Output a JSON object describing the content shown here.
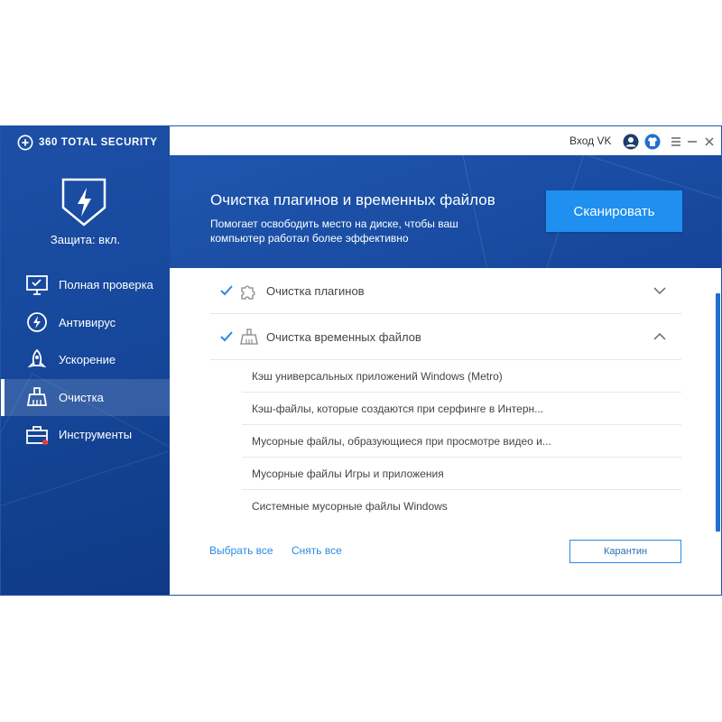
{
  "brand": {
    "name": "360 TOTAL SECURITY",
    "icon": "360-logo-icon"
  },
  "sidebar": {
    "protection_status": "Защита: вкл.",
    "items": [
      {
        "label": "Полная проверка",
        "icon": "monitor-check-icon",
        "active": false
      },
      {
        "label": "Антивирус",
        "icon": "antivirus-bolt-icon",
        "active": false
      },
      {
        "label": "Ускорение",
        "icon": "rocket-icon",
        "active": false
      },
      {
        "label": "Очистка",
        "icon": "broom-icon",
        "active": true
      },
      {
        "label": "Инструменты",
        "icon": "toolbox-icon",
        "active": false,
        "badge": true
      }
    ]
  },
  "topbar": {
    "login": "Вход VK",
    "icons": [
      "user-icon",
      "tshirt-skin-icon",
      "menu-icon",
      "minimize-icon",
      "close-icon"
    ]
  },
  "banner": {
    "title": "Очистка плагинов и временных файлов",
    "description": "Помогает освободить место на диске, чтобы ваш компьютер работал более эффективно",
    "scan_button": "Сканировать"
  },
  "groups": [
    {
      "label": "Очистка плагинов",
      "checked": true,
      "icon": "puzzle-icon",
      "expanded": false
    },
    {
      "label": "Очистка временных файлов",
      "checked": true,
      "icon": "broom-icon",
      "expanded": true
    }
  ],
  "temp_items": [
    "Кэш универсальных приложений Windows (Metro)",
    "Кэш-файлы, которые создаются при серфинге в Интерн...",
    "Мусорные файлы, образующиеся при просмотре видео и...",
    "Мусорные файлы Игры и приложения",
    "Системные мусорные файлы Windows"
  ],
  "footer": {
    "select_all": "Выбрать все",
    "deselect_all": "Снять все",
    "quarantine": "Карантин"
  },
  "colors": {
    "sidebar_bg": "#1a4da2",
    "accent_blue": "#1f8ff0",
    "link_blue": "#2a8ae5"
  }
}
